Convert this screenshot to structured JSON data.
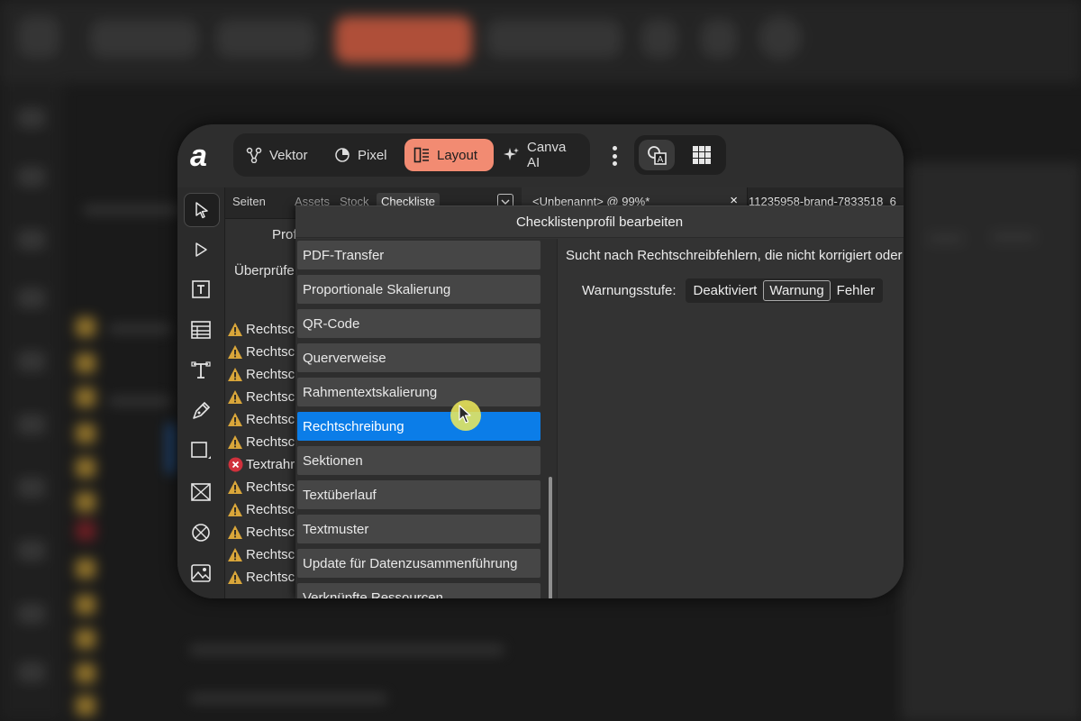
{
  "app": {
    "logo_glyph": "a"
  },
  "personas": [
    {
      "label": "Vektor",
      "icon": "vector-node-icon",
      "active": false
    },
    {
      "label": "Pixel",
      "icon": "pixel-brush-icon",
      "active": false
    },
    {
      "label": "Layout",
      "icon": "layout-icon",
      "active": true
    },
    {
      "label": "Canva AI",
      "icon": "sparkle-icon",
      "active": false
    }
  ],
  "left_panel": {
    "tabs": [
      "Seiten",
      "Assets",
      "Stock",
      "Checkliste"
    ],
    "active_tab": "Checkliste",
    "profile_label": "Prof",
    "check_label": "Überprüfe",
    "issues": [
      {
        "type": "warning",
        "text": "Rechtscl"
      },
      {
        "type": "warning",
        "text": "Rechtscl"
      },
      {
        "type": "warning",
        "text": "Rechtscl"
      },
      {
        "type": "warning",
        "text": "Rechtscl"
      },
      {
        "type": "warning",
        "text": "Rechtscl"
      },
      {
        "type": "warning",
        "text": "Rechtscl"
      },
      {
        "type": "error",
        "text": "Textrahr"
      },
      {
        "type": "warning",
        "text": "Rechtscl"
      },
      {
        "type": "warning",
        "text": "Rechtscl"
      },
      {
        "type": "warning",
        "text": "Rechtscl"
      },
      {
        "type": "warning",
        "text": "Rechtscl"
      },
      {
        "type": "warning",
        "text": "Rechtscl"
      }
    ]
  },
  "doc_tabs": {
    "first": "<Unbenannt> @ 99%*",
    "close_glyph": "×",
    "second": "11235958-brand-7833518_6"
  },
  "dialog": {
    "title": "Checklistenprofil bearbeiten",
    "items": [
      "PDF-Transfer",
      "Proportionale Skalierung",
      "QR-Code",
      "Querverweise",
      "Rahmentextskalierung",
      "Rechtschreibung",
      "Sektionen",
      "Textüberlauf",
      "Textmuster",
      "Update für Datenzusammenführung",
      "Verknüpfte Ressourcen"
    ],
    "selected_item": "Rechtschreibung",
    "description": "Sucht nach Rechtschreibfehlern, die nicht korrigiert oder",
    "warning_level_label": "Warnungsstufe:",
    "warning_levels": [
      "Deaktiviert",
      "Warnung",
      "Fehler"
    ],
    "selected_level": "Warnung"
  },
  "colors": {
    "accent_layout": "#f28b72",
    "selection_blue": "#0b7de8",
    "warning_yellow": "#d9a63a",
    "error_red": "#d0313c"
  }
}
